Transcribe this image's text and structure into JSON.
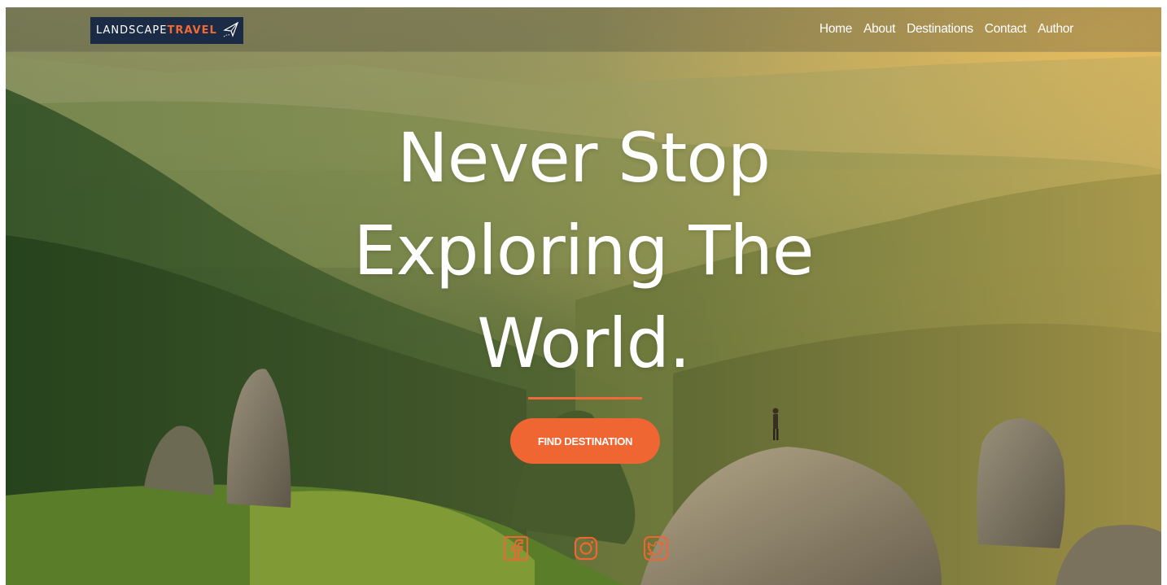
{
  "brand": {
    "logo_text_main": "LANDSCAPE",
    "logo_text_accent": "TRAVEL",
    "logo_bg": "#1b2a45",
    "accent_color": "#f06632"
  },
  "nav": {
    "items": [
      "Home",
      "About",
      "Destinations",
      "Contact",
      "Author"
    ]
  },
  "hero": {
    "headline_lines": [
      "Never Stop",
      "Exploring The",
      "World."
    ],
    "cta_label": "FIND DESTINATION"
  },
  "social": {
    "icons": [
      "facebook-icon",
      "instagram-icon",
      "twitter-icon"
    ]
  }
}
